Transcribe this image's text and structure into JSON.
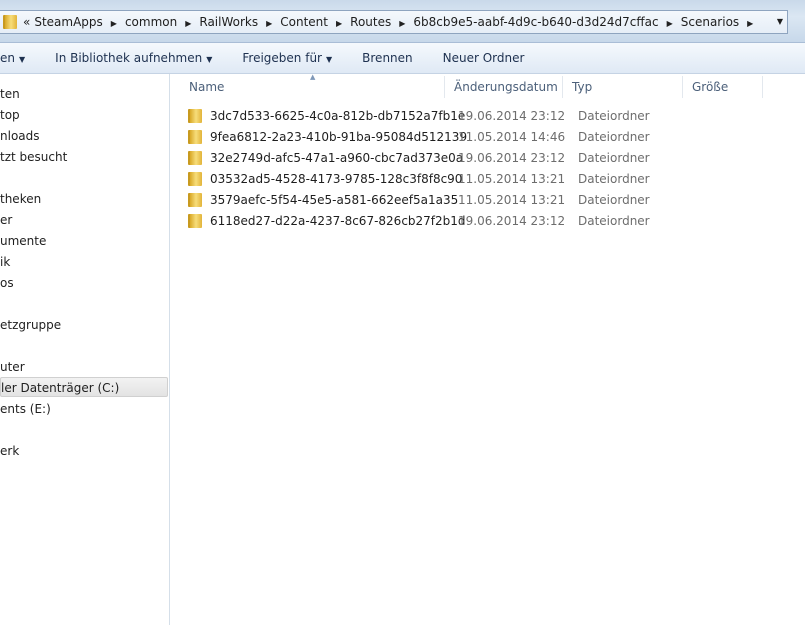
{
  "address": {
    "overflow": "«",
    "crumbs": [
      "SteamApps",
      "common",
      "RailWorks",
      "Content",
      "Routes",
      "6b8cb9e5-aabf-4d9c-b640-d3d24d7cffac",
      "Scenarios"
    ]
  },
  "toolbar": {
    "organize": "en",
    "library": "In Bibliothek aufnehmen",
    "share": "Freigeben für",
    "burn": "Brennen",
    "new_folder": "Neuer Ordner"
  },
  "nav": [
    "ten",
    "top",
    "nloads",
    "tzt besucht",
    "theken",
    "er",
    "umente",
    "ik",
    "os",
    "etzgruppe",
    "uter",
    "ler Datenträger (C:)",
    "ents (E:)",
    "erk"
  ],
  "columns": [
    "Name",
    "Änderungsdatum",
    "Typ",
    "Größe"
  ],
  "files": [
    {
      "name": "3dc7d533-6625-4c0a-812b-db7152a7fb1e",
      "date": "19.06.2014 23:12",
      "type": "Dateiordner"
    },
    {
      "name": "9fea6812-2a23-410b-91ba-95084d512139",
      "date": "11.05.2014 14:46",
      "type": "Dateiordner"
    },
    {
      "name": "32e2749d-afc5-47a1-a960-cbc7ad373e0a",
      "date": "19.06.2014 23:12",
      "type": "Dateiordner"
    },
    {
      "name": "03532ad5-4528-4173-9785-128c3f8f8c90",
      "date": "11.05.2014 13:21",
      "type": "Dateiordner"
    },
    {
      "name": "3579aefc-5f54-45e5-a581-662eef5a1a35",
      "date": "11.05.2014 13:21",
      "type": "Dateiordner"
    },
    {
      "name": "6118ed27-d22a-4237-8c67-826cb27f2b1d",
      "date": "19.06.2014 23:12",
      "type": "Dateiordner"
    }
  ]
}
